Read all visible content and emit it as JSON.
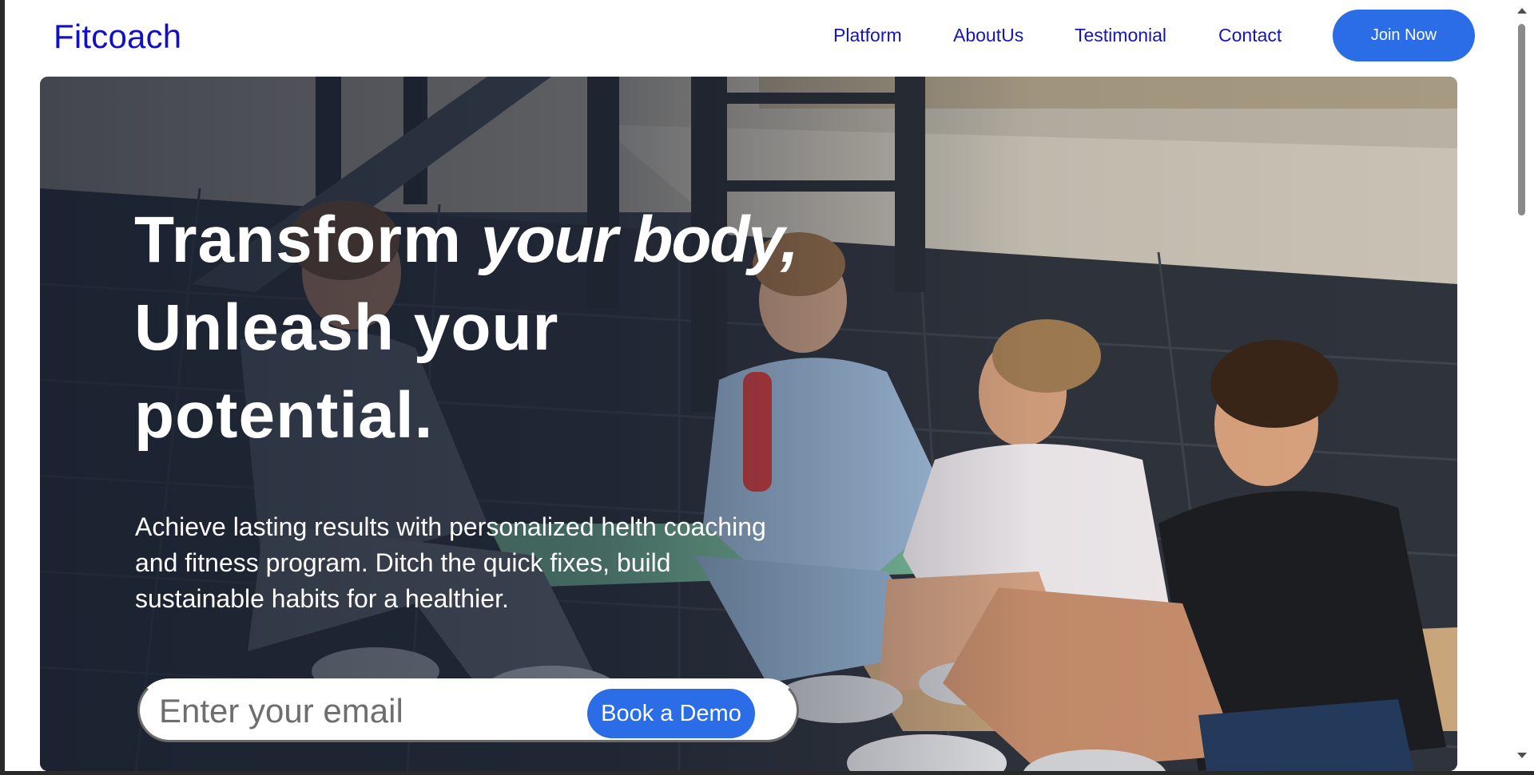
{
  "nav": {
    "logo": "Fitcoach",
    "links": [
      "Platform",
      "AboutUs",
      "Testimonial",
      "Contact"
    ],
    "join_label": "Join Now"
  },
  "hero": {
    "headline_part1": "Transform ",
    "headline_italic": "your body,",
    "headline_part2": " Unleash your potential.",
    "subtext": "Achieve lasting results with personalized helth coaching and fitness program. Ditch the quick fixes, build sustainable habits for a healthier.",
    "email_placeholder": "Enter your email",
    "demo_label": "Book a Demo"
  },
  "colors": {
    "brand_blue": "#2b6de6",
    "link_blue": "#1515b8",
    "logo_blue": "#1010c8"
  }
}
